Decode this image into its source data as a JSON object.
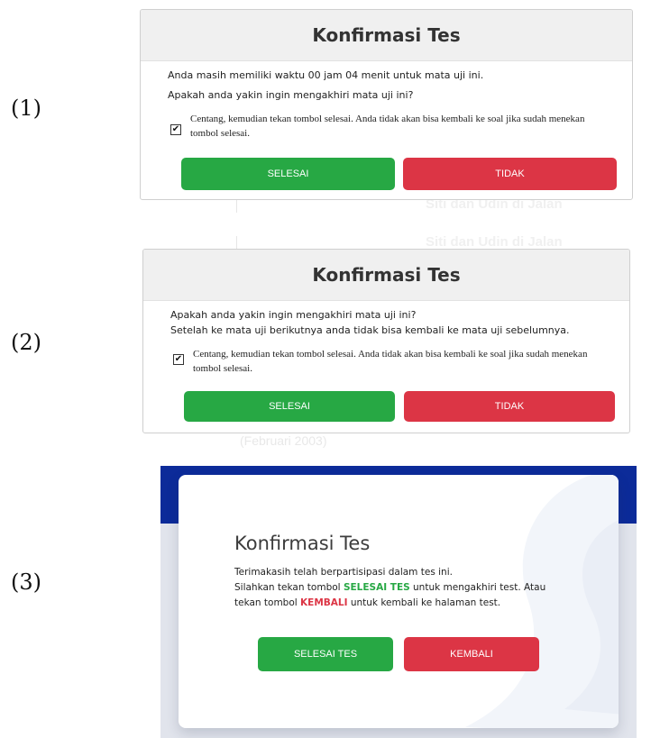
{
  "panel_labels": [
    "(1)",
    "(2)",
    "(3)"
  ],
  "background_text": {
    "line1": "Siti dan Udin di Jalan",
    "line2": "Siti dan Udin di Jalan",
    "date": "(Februari 2003)"
  },
  "dialog1": {
    "title": "Konfirmasi Tes",
    "line1": "Anda masih memiliki waktu 00 jam 04 menit untuk mata uji ini.",
    "line2": "Apakah anda yakin ingin mengakhiri mata uji ini?",
    "checkbox_checked": true,
    "checkbox_text": "Centang, kemudian tekan tombol selesai. Anda tidak akan bisa kembali ke soal jika sudah menekan tombol selesai.",
    "confirm_label": "SELESAI",
    "cancel_label": "TIDAK"
  },
  "dialog2": {
    "title": "Konfirmasi Tes",
    "line1": "Apakah anda yakin ingin mengakhiri mata uji ini?",
    "line2": "Setelah ke mata uji berikutnya anda tidak bisa kembali ke mata uji sebelumnya.",
    "checkbox_checked": true,
    "checkbox_text": "Centang, kemudian tekan tombol selesai. Anda tidak akan bisa kembali ke soal jika sudah menekan tombol selesai.",
    "confirm_label": "SELESAI",
    "cancel_label": "TIDAK"
  },
  "dialog3": {
    "title": "Konfirmasi Tes",
    "line1": "Terimakasih telah berpartisipasi dalam tes ini.",
    "line2_pre": "Silahkan tekan tombol ",
    "line2_keyword": "SELESAI TES",
    "line2_post": " untuk mengakhiri test. Atau",
    "line3_pre": "tekan tombol ",
    "line3_keyword": "KEMBALI",
    "line3_post": " untuk kembali ke halaman test.",
    "confirm_label": "SELESAI TES",
    "back_label": "KEMBALI"
  },
  "colors": {
    "confirm": "#27a844",
    "cancel": "#dc3545",
    "header_bar": "#0c2b99",
    "dialog_header": "#f0f0f0"
  },
  "icons": [
    "checkmark-icon",
    "watermark-logo"
  ]
}
